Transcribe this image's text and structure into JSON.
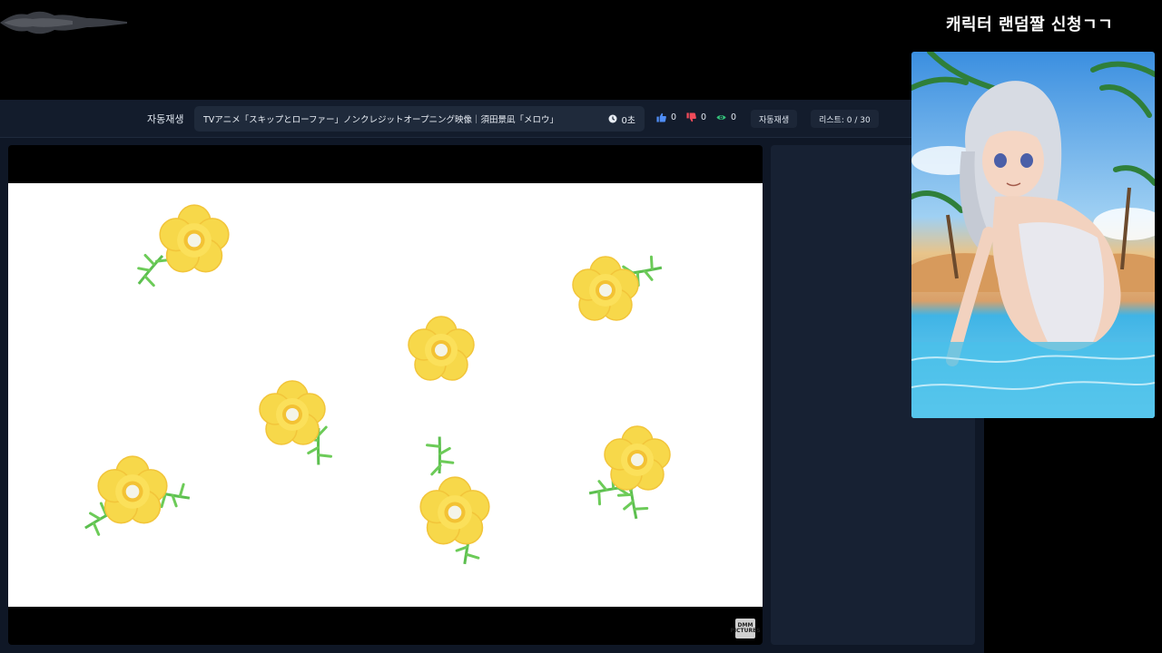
{
  "overlay": {
    "stream_title": "캐릭터 랜덤짤 신청ㄱㄱ",
    "waveform_icon": "audio-waveform-icon",
    "character_image_alt": "anime character image"
  },
  "topbar": {
    "autoplay_label": "자동재생",
    "now_playing_title": "TVアニメ「スキップとローファー」ノンクレジットオープニング映像｜須田景凪「メロウ」",
    "elapsed": "0초",
    "likes": "0",
    "dislikes": "0",
    "views": "0",
    "autoplay_button": "자동재생",
    "list_counter": "리스트: 0 / 30"
  },
  "player": {
    "watermark": "DMM PICTURES"
  },
  "colors": {
    "app_bg": "#0f1726",
    "topbar_bg": "#131c2c",
    "like": "#4f8df5",
    "dislike": "#f04b5a",
    "views": "#34c27a",
    "flower": "#f7d84a"
  },
  "icons": {
    "clock": "clock-icon",
    "like": "thumbs-up-icon",
    "dislike": "thumbs-down-icon",
    "views": "eye-icon"
  }
}
